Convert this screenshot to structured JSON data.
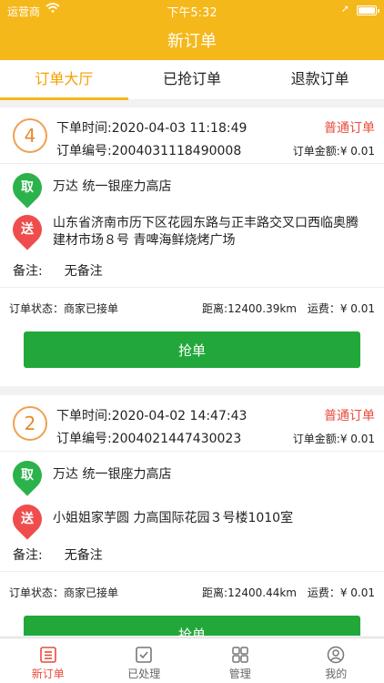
{
  "status": {
    "carrier": "运营商",
    "time": "下午5:32"
  },
  "nav": {
    "title": "新订单"
  },
  "tabs": [
    {
      "label": "订单大厅",
      "active": true
    },
    {
      "label": "已抢订单",
      "active": false
    },
    {
      "label": "退款订单",
      "active": false
    }
  ],
  "labels": {
    "order_time": "下单时间:",
    "order_no": "订单编号:",
    "amount": "订单金额:",
    "remark": "备注:",
    "state": "订单状态：",
    "distance": "距离:",
    "fee": "运费：",
    "grab": "抢单",
    "pickup": "取",
    "deliver": "送"
  },
  "orders": [
    {
      "num": "4",
      "time": "2020-04-03 11:18:49",
      "no": "2004031118490008",
      "type": "普通订单",
      "amount": "¥ 0.01",
      "pickup": "万达   统一银座力高店",
      "delivery": "山东省济南市历下区花园东路与正丰路交叉口西临奥腾建材市场８号 青啤海鲜烧烤广场",
      "remark": "无备注",
      "state": "商家已接单",
      "distance": "12400.39km",
      "fee": "¥ 0.01"
    },
    {
      "num": "2",
      "time": "2020-04-02 14:47:43",
      "no": "2004021447430023",
      "type": "普通订单",
      "amount": "¥ 0.01",
      "pickup": "万达   统一银座力高店",
      "delivery": "小姐姐家芋圆 力高国际花园３号楼1010室",
      "remark": "无备注",
      "state": "商家已接单",
      "distance": "12400.44km",
      "fee": "¥ 0.01"
    }
  ],
  "bottom_tabs": [
    {
      "label": "新订单",
      "icon": "list-icon",
      "active": true
    },
    {
      "label": "已处理",
      "icon": "check-box-icon",
      "active": false
    },
    {
      "label": "管理",
      "icon": "grid-icon",
      "active": false
    },
    {
      "label": "我的",
      "icon": "user-icon",
      "active": false
    }
  ]
}
